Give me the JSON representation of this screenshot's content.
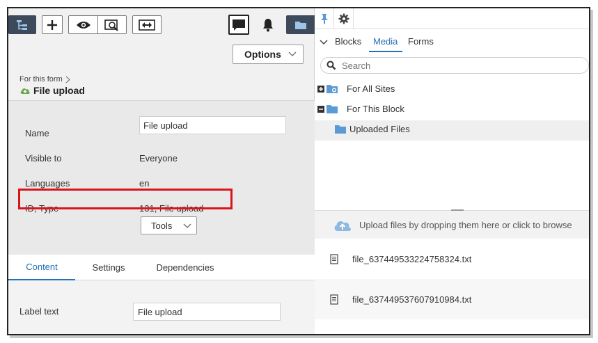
{
  "toolbar": {
    "icons": [
      "sitemap-icon",
      "plus-icon",
      "eye-icon",
      "preview-icon",
      "arrows-icon",
      "comment-icon",
      "bell-icon",
      "folder-icon"
    ],
    "options_label": "Options"
  },
  "breadcrumb": {
    "parent": "For this form"
  },
  "form": {
    "title": "File upload"
  },
  "properties": {
    "name_label": "Name",
    "name_value": "File upload",
    "visible_label": "Visible to",
    "visible_value": "Everyone",
    "languages_label": "Languages",
    "languages_value": "en",
    "id_type_label": "ID, Type",
    "id_type_value": "131, File upload",
    "tools_label": "Tools"
  },
  "tabs": [
    {
      "label": "Content",
      "active": true
    },
    {
      "label": "Settings",
      "active": false
    },
    {
      "label": "Dependencies",
      "active": false
    }
  ],
  "content": {
    "label_text_label": "Label text",
    "label_text_value": "File upload"
  },
  "assets": {
    "tabs": [
      {
        "label": "Blocks",
        "active": false
      },
      {
        "label": "Media",
        "active": true
      },
      {
        "label": "Forms",
        "active": false
      }
    ],
    "search_placeholder": "Search",
    "tree": [
      {
        "label": "For All Sites",
        "expanded": false
      },
      {
        "label": "For This Block",
        "expanded": true
      },
      {
        "label": "Uploaded Files",
        "selected": true
      }
    ],
    "upload_text": "Upload files by dropping them here or click to browse",
    "files": [
      {
        "name": "file_637449533224758324.txt"
      },
      {
        "name": "file_637449537607910984.txt"
      }
    ]
  },
  "colors": {
    "accent": "#2670b8",
    "highlight": "#d9141b",
    "folder": "#5b9bd5",
    "toolbar_dark": "#3c4a5c",
    "form_icon": "#6aa84f"
  }
}
